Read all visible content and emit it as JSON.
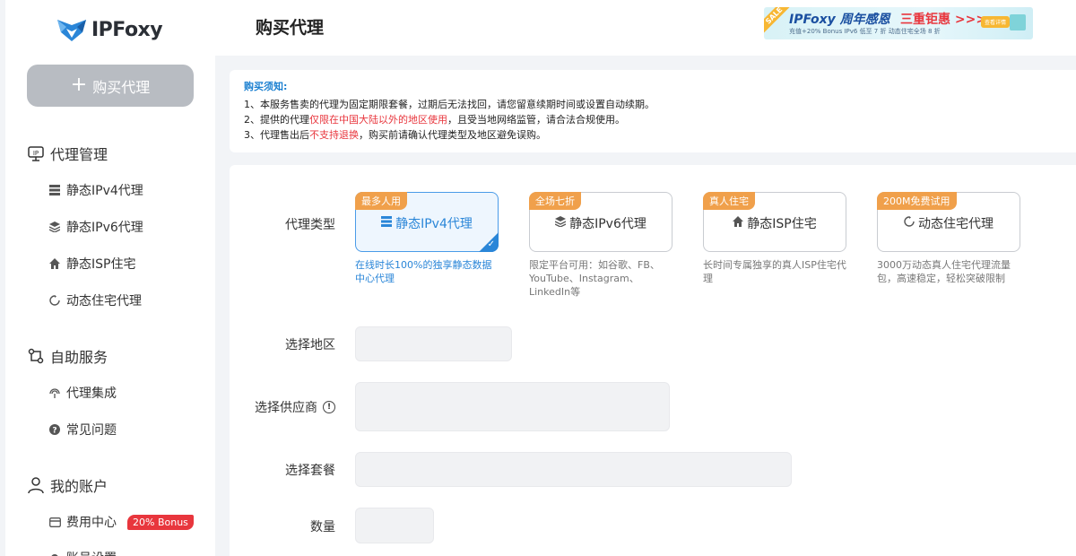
{
  "app": {
    "brand": "IPFoxy"
  },
  "sidebar": {
    "buy_button": "购买代理",
    "groups": [
      {
        "title": "代理管理",
        "icon": "proxy-manage-icon"
      },
      {
        "title": "自助服务",
        "icon": "self-service-icon"
      },
      {
        "title": "我的账户",
        "icon": "user-icon"
      }
    ],
    "items": [
      {
        "label": "静态IPv4代理",
        "icon": "server-icon"
      },
      {
        "label": "静态IPv6代理",
        "icon": "layers-icon"
      },
      {
        "label": "静态ISP住宅",
        "icon": "home-icon"
      },
      {
        "label": "动态住宅代理",
        "icon": "refresh-icon"
      },
      {
        "label": "代理集成",
        "icon": "integration-icon"
      },
      {
        "label": "常见问题",
        "icon": "question-icon"
      },
      {
        "label": "费用中心",
        "icon": "card-icon",
        "badge": "20% Bonus"
      },
      {
        "label": "账号设置",
        "icon": "settings-icon"
      }
    ]
  },
  "header": {
    "title": "购买代理",
    "banner": {
      "sale": "SALE",
      "headline": "IPFoxy 周年感恩",
      "highlight": "三重钜惠 >>>",
      "sub": "充值+20% Bonus   IPv6 低至 7 折   动态住宅全场 8 折",
      "button": "查看详情"
    }
  },
  "notice": {
    "title": "购买须知:",
    "line1": "1、本服务售卖的代理为固定期限套餐，过期后无法找回，请您留意续期时间或设置自动续期。",
    "line2_a": "2、提供的代理",
    "line2_red": "仅限在中国大陆以外的地区使用",
    "line2_b": "，且受当地网络监管，请合法合规使用。",
    "line3_a": "3、代理售出后",
    "line3_red": "不支持退换",
    "line3_b": "，购买前请确认代理类型及地区避免误购。"
  },
  "form": {
    "type_label": "代理类型",
    "region_label": "选择地区",
    "provider_label": "选择供应商",
    "package_label": "选择套餐",
    "quantity_label": "数量",
    "types": [
      {
        "tag": "最多人用",
        "name": "静态IPv4代理",
        "desc": "在线时长100%的独享静态数据中心代理",
        "selected": true
      },
      {
        "tag": "全场七折",
        "name": "静态IPv6代理",
        "desc": "限定平台可用：如谷歌、FB、YouTube、Instagram、LinkedIn等",
        "selected": false
      },
      {
        "tag": "真人住宅",
        "name": "静态ISP住宅",
        "desc": "长时间专属独享的真人ISP住宅代理",
        "selected": false
      },
      {
        "tag": "200M免费试用",
        "name": "动态住宅代理",
        "desc": "3000万动态真人住宅代理流量包，高速稳定，轻松突破限制",
        "selected": false
      }
    ]
  },
  "colors": {
    "accent": "#2a86d8",
    "tag": "#f0a04b",
    "danger": "#e8363d"
  }
}
